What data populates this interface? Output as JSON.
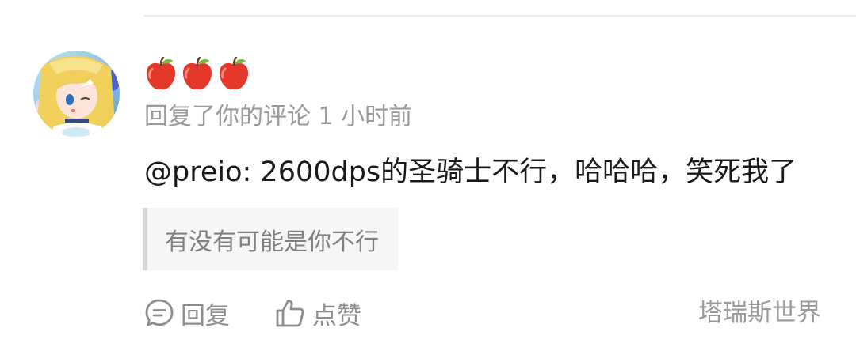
{
  "comment": {
    "username_icons": [
      "apple-icon",
      "apple-icon",
      "apple-icon"
    ],
    "meta": "回复了你的评论 1 小时前",
    "text": "@preio: 2600dps的圣骑士不行，哈哈哈，笑死我了",
    "quote": "有没有可能是你不行"
  },
  "actions": {
    "reply_label": "回复",
    "like_label": "点赞"
  },
  "source": "塔瑞斯世界",
  "colors": {
    "primary_text": "#1a1a1a",
    "secondary_text": "#9a9a9a",
    "quote_bg": "#f6f6f7",
    "quote_bar": "#d7d9dc",
    "apple": "#e4382a"
  }
}
